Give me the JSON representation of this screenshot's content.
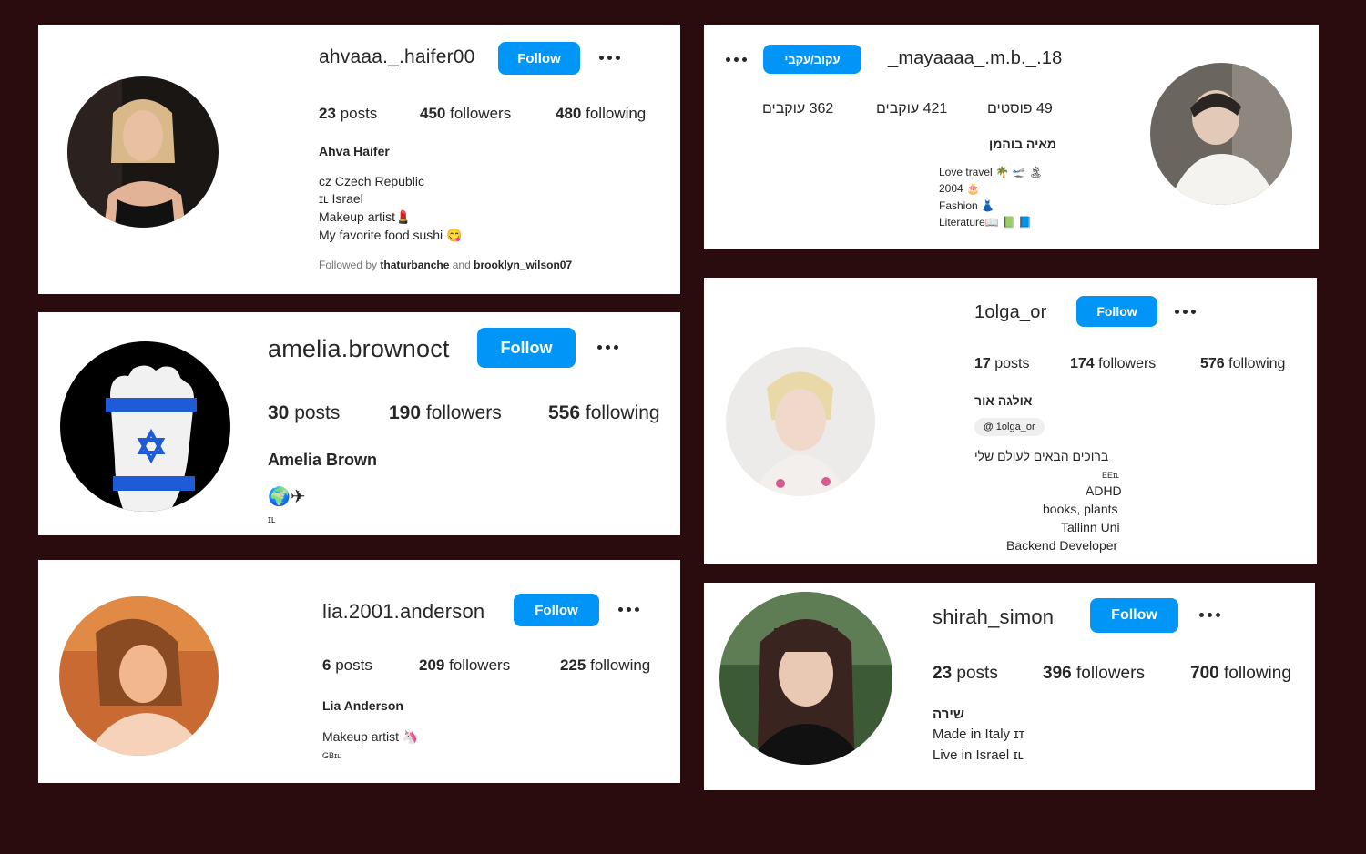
{
  "profiles": {
    "p1": {
      "username": "ahvaaa._.haifer00",
      "button": "Follow",
      "posts": "23",
      "posts_label": "posts",
      "followers": "450",
      "followers_label": "followers",
      "following": "480",
      "following_label": "following",
      "name": "Ahva Haifer",
      "bio": [
        "cz Czech Republic",
        "ɪʟ Israel",
        "Makeup artist💄",
        "My favorite food sushi 😋"
      ],
      "followed_prefix": "Followed by",
      "followed_user1": "thaturbanche",
      "followed_and": "and",
      "followed_user2": "brooklyn_wilson07"
    },
    "p2": {
      "username": "_mayaaaa_.m.b._.18",
      "button": "עקוב/עקבי",
      "stat1": "362 עוקבים",
      "stat2": "421 עוקבים",
      "stat3": "49 פוסטים",
      "name": "מאיה בוהמן",
      "bio": [
        "Love travel 🌴 🛫 🏝",
        "2004 🎂",
        "Fashion 👗",
        "Literature📖 📗 📘"
      ]
    },
    "p3": {
      "username": "amelia.brownoct",
      "button": "Follow",
      "posts": "30",
      "posts_label": "posts",
      "followers": "190",
      "followers_label": "followers",
      "following": "556",
      "following_label": "following",
      "name": "Amelia Brown",
      "emoji": "🌍✈",
      "flag": "ɪʟ"
    },
    "p4": {
      "username": "1olga_or",
      "button": "Follow",
      "posts": "17",
      "posts_label": "posts",
      "followers": "174",
      "followers_label": "followers",
      "following": "576",
      "following_label": "following",
      "name": "אולגה אור",
      "threads": "1olga_or",
      "bio_rtl": "ברוכים הבאים לעולם שלי",
      "bio": [
        "EEɪʟ",
        "ADHD",
        "books, plants",
        "Tallinn Uni",
        "Backend Developer"
      ]
    },
    "p5": {
      "username": "lia.2001.anderson",
      "button": "Follow",
      "posts": "6",
      "posts_label": "posts",
      "followers": "209",
      "followers_label": "followers",
      "following": "225",
      "following_label": "following",
      "name": "Lia Anderson",
      "bio": [
        "Makeup artist 🦄",
        "GBɪʟ"
      ]
    },
    "p6": {
      "username": "shirah_simon",
      "button": "Follow",
      "posts": "23",
      "posts_label": "posts",
      "followers": "396",
      "followers_label": "followers",
      "following": "700",
      "following_label": "following",
      "name": "שירה",
      "bio": [
        "Made in Italy ɪᴛ",
        "Live in Israel ɪʟ"
      ]
    }
  },
  "colors": {
    "background": "#2a0c0f",
    "follow_button": "#0095f6",
    "card": "#ffffff"
  }
}
